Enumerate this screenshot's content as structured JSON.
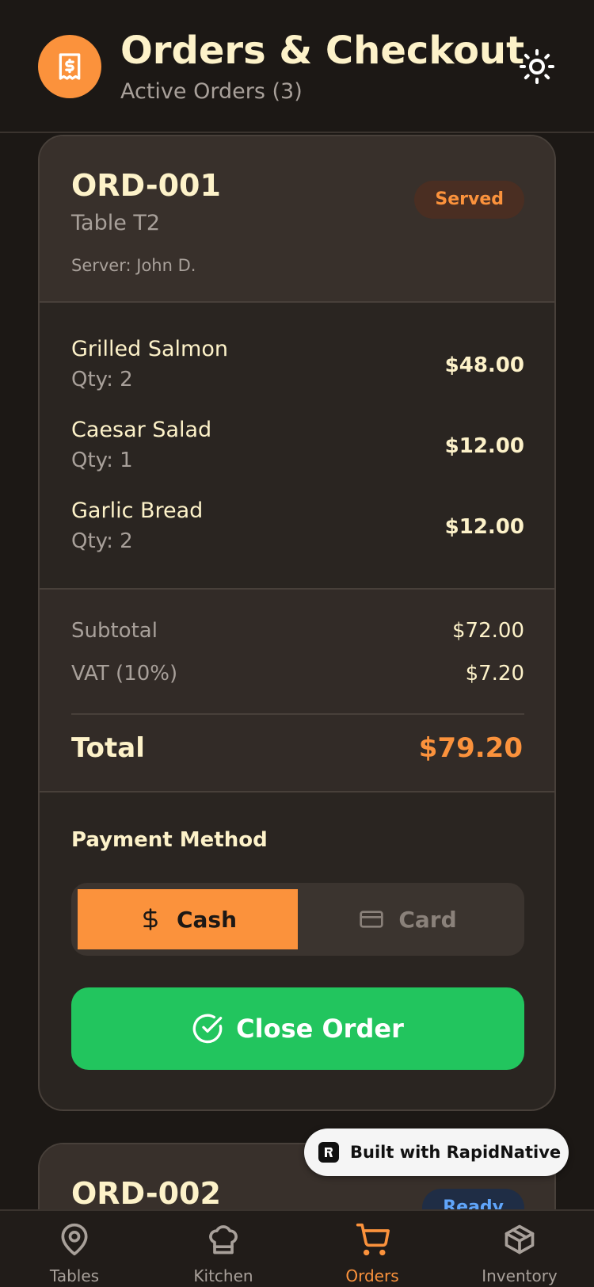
{
  "header": {
    "logo_icon": "receipt-icon",
    "title": "Orders & Checkout",
    "subtitle": "Active Orders (3)",
    "theme_icon": "sun-icon"
  },
  "orders": [
    {
      "id": "ORD-001",
      "table": "Table T2",
      "server": "Server: John D.",
      "status": "Served",
      "items": [
        {
          "name": "Grilled Salmon",
          "qty": "Qty: 2",
          "price": "$48.00"
        },
        {
          "name": "Caesar Salad",
          "qty": "Qty: 1",
          "price": "$12.00"
        },
        {
          "name": "Garlic Bread",
          "qty": "Qty: 2",
          "price": "$12.00"
        }
      ],
      "subtotal_label": "Subtotal",
      "subtotal": "$72.00",
      "vat_label": "VAT (10%)",
      "vat": "$7.20",
      "total_label": "Total",
      "total": "$79.20",
      "payment_label": "Payment Method",
      "payment_options": [
        "Cash",
        "Card"
      ],
      "payment_selected": "Cash",
      "close_label": "Close Order"
    },
    {
      "id": "ORD-002",
      "status": "Ready"
    }
  ],
  "badge": {
    "text": "Built with RapidNative"
  },
  "nav": [
    {
      "label": "Tables",
      "icon": "map-pin-icon"
    },
    {
      "label": "Kitchen",
      "icon": "chef-hat-icon"
    },
    {
      "label": "Orders",
      "icon": "shopping-cart-icon",
      "active": true
    },
    {
      "label": "Inventory",
      "icon": "package-icon"
    }
  ],
  "colors": {
    "background": "#1c1815",
    "accent": "#fb923c",
    "success": "#22c55e",
    "text_primary": "#fdf2c9",
    "text_muted": "#a8a09a",
    "ready": "#60a5fa"
  }
}
